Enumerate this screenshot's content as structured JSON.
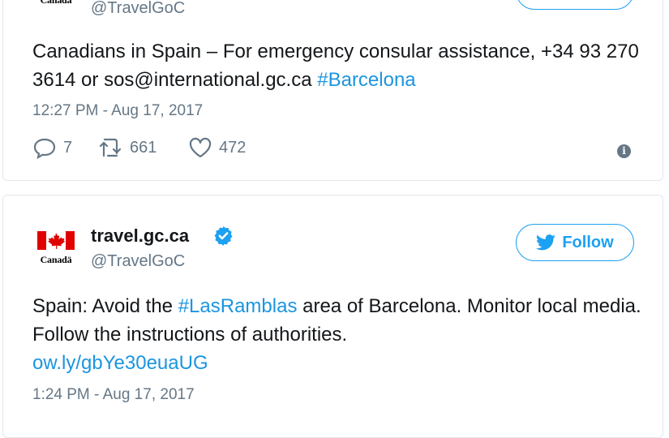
{
  "account": {
    "display_name": "travel.gc.ca",
    "handle": "@TravelGoC",
    "wordmark": "Canadä",
    "verified": true
  },
  "colors": {
    "link": "#1b95e0",
    "follow_border": "#1da1f2",
    "flag_red": "#e00000",
    "verified_blue": "#1da1f2",
    "secondary_text": "#657786"
  },
  "tweets": [
    {
      "text_before": "Canadians in Spain – For emergency consular assistance, +34 93 270 3614 or sos@international.gc.ca ",
      "hashtag": "#Barcelona",
      "timestamp": "12:27 PM - Aug 17, 2017",
      "replies": "7",
      "retweets": "661",
      "likes": "472",
      "icons": [
        "reply-icon",
        "retweet-icon",
        "like-icon",
        "info-icon"
      ]
    },
    {
      "follow_label": "Follow",
      "text_before": "Spain: Avoid the ",
      "hashtag": "#LasRamblas",
      "text_after": " area of Barcelona. Monitor local media. Follow the instructions of authorities.",
      "link": "ow.ly/gbYe30euaUG",
      "timestamp": "1:24 PM - Aug 17, 2017",
      "icons": [
        "canada-flag-icon",
        "verified-badge-icon",
        "twitter-bird-icon"
      ]
    }
  ]
}
